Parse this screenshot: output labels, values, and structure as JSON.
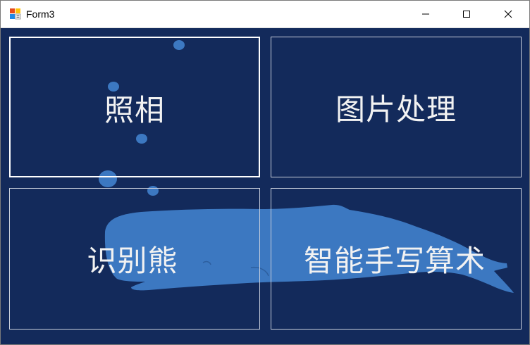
{
  "window": {
    "title": "Form3",
    "icon": "winforms-app-icon"
  },
  "titlebar_buttons": {
    "minimize": "minimize-icon",
    "maximize": "maximize-icon",
    "close": "close-icon"
  },
  "tiles": [
    {
      "label": "照相"
    },
    {
      "label": "图片处理"
    },
    {
      "label": "识别熊"
    },
    {
      "label": "智能手写算术"
    }
  ],
  "colors": {
    "background": "#132a5b",
    "whale": "#3c78c1",
    "tile_text": "#f2f2f2",
    "tile_border": "#c9cfdc"
  }
}
